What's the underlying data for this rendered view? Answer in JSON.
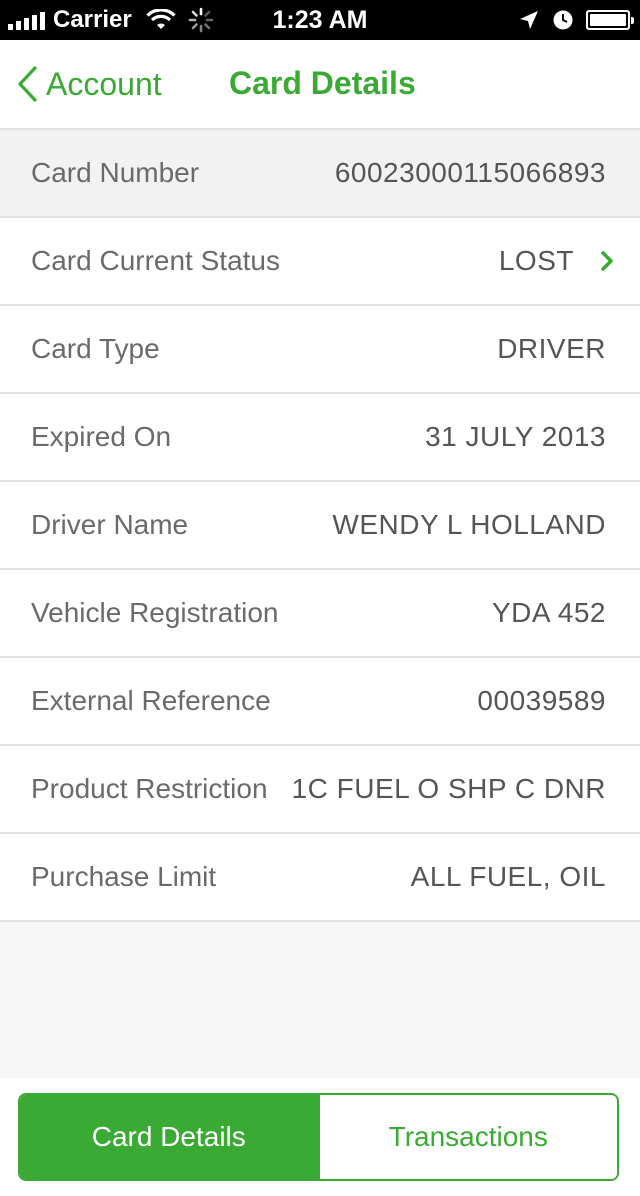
{
  "status_bar": {
    "carrier": "Carrier",
    "time": "1:23 AM",
    "signal_bars": 5,
    "battery_level": 1.0
  },
  "nav": {
    "back_label": "Account",
    "title": "Card Details",
    "accent_color": "#3aaa35"
  },
  "rows": [
    {
      "label": "Card Number",
      "value": "60023000115066893"
    },
    {
      "label": "Card Current Status",
      "value": "LOST"
    },
    {
      "label": "Card Type",
      "value": "DRIVER"
    },
    {
      "label": "Expired On",
      "value": "31 JULY 2013"
    },
    {
      "label": "Driver Name",
      "value": "WENDY L HOLLAND"
    },
    {
      "label": "Vehicle Registration",
      "value": "YDA 452"
    },
    {
      "label": "External Reference",
      "value": "00039589"
    },
    {
      "label": "Product Restriction",
      "value": "1C FUEL O SHP C DNR"
    },
    {
      "label": "Purchase Limit",
      "value": "ALL FUEL, OIL"
    }
  ],
  "segments": {
    "active": "Card Details",
    "inactive": "Transactions"
  }
}
